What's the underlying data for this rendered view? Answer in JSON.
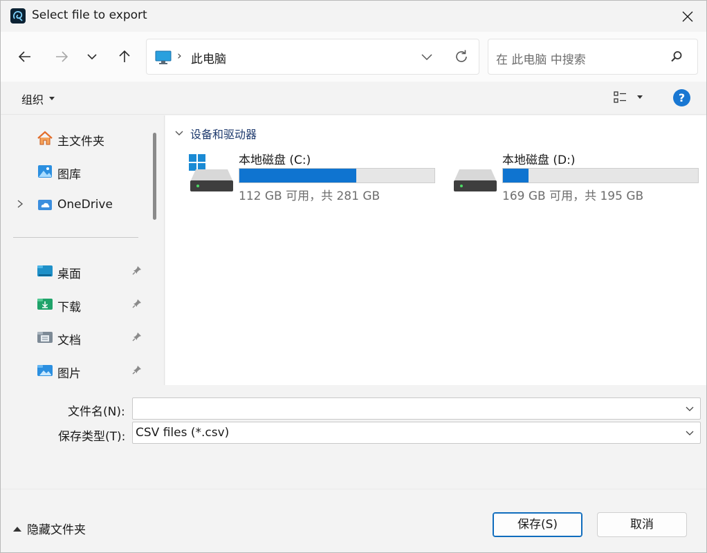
{
  "window": {
    "title": "Select file to export",
    "close": "✕"
  },
  "nav": {
    "address_sep": "›",
    "address_location": "此电脑",
    "search_placeholder": "在 此电脑 中搜索"
  },
  "toolbar": {
    "organize": "组织",
    "help": "?"
  },
  "sidebar": {
    "items": [
      {
        "label": "主文件夹",
        "icon": "home-icon"
      },
      {
        "label": "图库",
        "icon": "gallery-icon"
      },
      {
        "label": "OneDrive",
        "icon": "onedrive-cloud-icon"
      }
    ],
    "quick_access": [
      {
        "label": "桌面",
        "icon": "desktop-folder-icon",
        "pinned": true
      },
      {
        "label": "下载",
        "icon": "downloads-folder-icon",
        "pinned": true
      },
      {
        "label": "文档",
        "icon": "documents-folder-icon",
        "pinned": true
      },
      {
        "label": "图片",
        "icon": "pictures-folder-icon",
        "pinned": true
      }
    ]
  },
  "content": {
    "group_header": "设备和驱动器",
    "drives": [
      {
        "name": "本地磁盘 (C:)",
        "free_text": "112 GB 可用，共 281 GB",
        "used_fraction": 0.6,
        "system": true
      },
      {
        "name": "本地磁盘 (D:)",
        "free_text": "169 GB 可用，共 195 GB",
        "used_fraction": 0.13,
        "system": false
      }
    ]
  },
  "form": {
    "filename_label": "文件名(N):",
    "filename_value": "",
    "filetype_label": "保存类型(T):",
    "filetype_value": "CSV files (*.csv)"
  },
  "footer": {
    "hide_folders": "隐藏文件夹",
    "save": "保存(S)",
    "cancel": "取消"
  },
  "colors": {
    "accent": "#0f74d0",
    "help": "#1977d2",
    "group_header": "#1e3a6e"
  }
}
